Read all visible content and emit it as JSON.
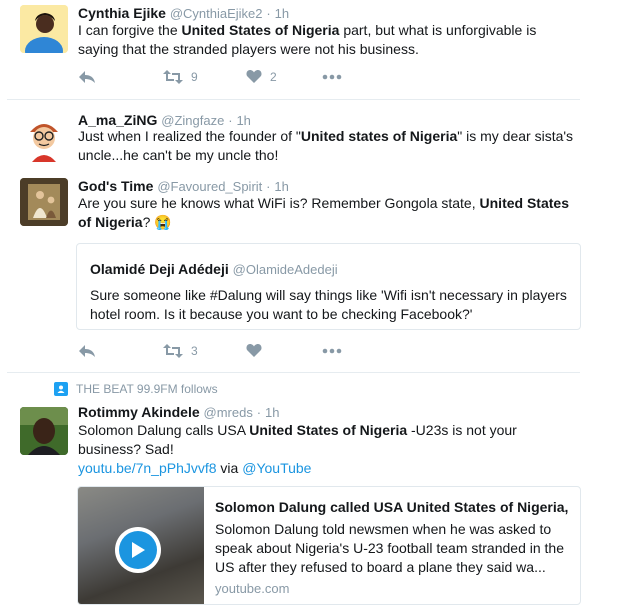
{
  "tweets": [
    {
      "name": "Cynthia Ejike",
      "handle": "@CynthiaEjike2",
      "time": "1h",
      "text_parts": [
        "I can forgive the ",
        "United States of Nigeria",
        " part, but what is unforgivable is saying that the stranded players were not his business."
      ],
      "retweets": "9",
      "likes": "2"
    },
    {
      "name": "A_ma_ZiNG",
      "handle": "@Zingfaze",
      "time": "1h",
      "text_parts": [
        "Just when I realized the founder of \"",
        "United states of Nigeria",
        "\" is my dear sista's uncle...he can't be my uncle tho!"
      ]
    },
    {
      "name": "God's Time",
      "handle": "@Favoured_Spirit",
      "time": "1h",
      "text_parts": [
        "Are you sure he knows what WiFi is? Remember Gongola state, ",
        "United States of Nigeria",
        "? 😭"
      ],
      "retweets": "3",
      "quote": {
        "name": "Olamidé Deji Adédeji",
        "handle": "@OlamideAdedeji",
        "text": "Sure someone like #Dalung will say things like 'Wifi isn't necessary in players hotel room. Is it because you want to be checking Facebook?'"
      }
    },
    {
      "follows_text": "THE BEAT 99.9FM follows",
      "name": "Rotimmy Akindele",
      "handle": "@mreds",
      "time": "1h",
      "text_parts": [
        "Solomon Dalung calls USA ",
        "United States of Nigeria",
        " -U23s is not your business? Sad!"
      ],
      "link_text": "youtu.be/7n_pPhJvvf8",
      "via": " via ",
      "via_handle": "@YouTube",
      "card": {
        "title": "Solomon Dalung called USA United States of Nigeria,",
        "description": "Solomon Dalung told newsmen when he was asked to speak about Nigeria's U-23 football team stranded in the US after they refused to board a plane they said wa...",
        "domain": "youtube.com"
      }
    }
  ],
  "separator": "·",
  "icons": [
    "reply-icon",
    "retweet-icon",
    "like-icon",
    "more-icon",
    "play-icon",
    "follows-icon"
  ],
  "colors": {
    "link": "#1b95e0",
    "muted": "#8899a6",
    "divider": "#e6ecf0"
  }
}
